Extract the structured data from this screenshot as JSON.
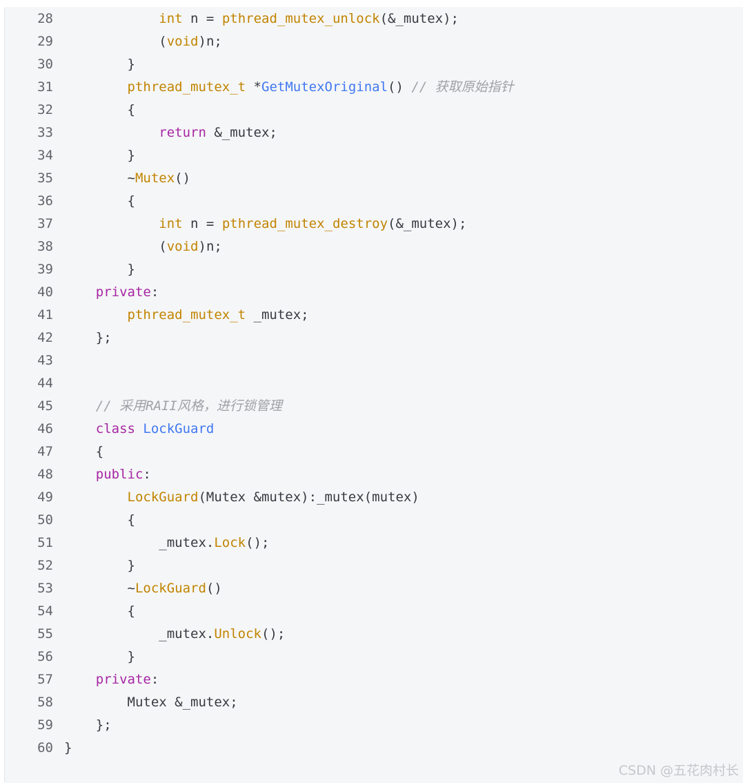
{
  "code_block": {
    "lines": [
      {
        "num": "28",
        "indent": "        ",
        "tokens": [
          {
            "t": "int",
            "c": "type"
          },
          {
            "t": " n = ",
            "c": "p"
          },
          {
            "t": "pthread_mutex_unlock",
            "c": "fn"
          },
          {
            "t": "(&_mutex);",
            "c": "p"
          }
        ]
      },
      {
        "num": "29",
        "indent": "        ",
        "tokens": [
          {
            "t": "(",
            "c": "p"
          },
          {
            "t": "void",
            "c": "type"
          },
          {
            "t": ")n;",
            "c": "p"
          }
        ]
      },
      {
        "num": "30",
        "indent": "    ",
        "tokens": [
          {
            "t": "}",
            "c": "p"
          }
        ]
      },
      {
        "num": "31",
        "indent": "    ",
        "tokens": [
          {
            "t": "pthread_mutex_t",
            "c": "type"
          },
          {
            "t": " *",
            "c": "p"
          },
          {
            "t": "GetMutexOriginal",
            "c": "call"
          },
          {
            "t": "() ",
            "c": "p"
          },
          {
            "t": "// 获取原始指针",
            "c": "cm"
          }
        ]
      },
      {
        "num": "32",
        "indent": "    ",
        "tokens": [
          {
            "t": "{",
            "c": "p"
          }
        ]
      },
      {
        "num": "33",
        "indent": "        ",
        "tokens": [
          {
            "t": "return",
            "c": "kw"
          },
          {
            "t": " &_mutex;",
            "c": "p"
          }
        ]
      },
      {
        "num": "34",
        "indent": "    ",
        "tokens": [
          {
            "t": "}",
            "c": "p"
          }
        ]
      },
      {
        "num": "35",
        "indent": "    ",
        "tokens": [
          {
            "t": "~",
            "c": "p"
          },
          {
            "t": "Mutex",
            "c": "fn"
          },
          {
            "t": "()",
            "c": "p"
          }
        ]
      },
      {
        "num": "36",
        "indent": "    ",
        "tokens": [
          {
            "t": "{",
            "c": "p"
          }
        ]
      },
      {
        "num": "37",
        "indent": "        ",
        "tokens": [
          {
            "t": "int",
            "c": "type"
          },
          {
            "t": " n = ",
            "c": "p"
          },
          {
            "t": "pthread_mutex_destroy",
            "c": "fn"
          },
          {
            "t": "(&_mutex);",
            "c": "p"
          }
        ]
      },
      {
        "num": "38",
        "indent": "        ",
        "tokens": [
          {
            "t": "(",
            "c": "p"
          },
          {
            "t": "void",
            "c": "type"
          },
          {
            "t": ")n;",
            "c": "p"
          }
        ]
      },
      {
        "num": "39",
        "indent": "    ",
        "tokens": [
          {
            "t": "}",
            "c": "p"
          }
        ]
      },
      {
        "num": "40",
        "indent": "",
        "tokens": [
          {
            "t": "private",
            "c": "kw"
          },
          {
            "t": ":",
            "c": "p"
          }
        ]
      },
      {
        "num": "41",
        "indent": "    ",
        "tokens": [
          {
            "t": "pthread_mutex_t",
            "c": "type"
          },
          {
            "t": " _mutex;",
            "c": "p"
          }
        ]
      },
      {
        "num": "42",
        "indent": "",
        "tokens": [
          {
            "t": "};",
            "c": "p"
          }
        ]
      },
      {
        "num": "43",
        "indent": "",
        "tokens": []
      },
      {
        "num": "44",
        "indent": "",
        "tokens": []
      },
      {
        "num": "45",
        "indent": "",
        "tokens": [
          {
            "t": "// 采用RAII风格，进行锁管理",
            "c": "cm"
          }
        ]
      },
      {
        "num": "46",
        "indent": "",
        "tokens": [
          {
            "t": "class",
            "c": "kw"
          },
          {
            "t": " ",
            "c": "p"
          },
          {
            "t": "LockGuard",
            "c": "class"
          }
        ]
      },
      {
        "num": "47",
        "indent": "",
        "tokens": [
          {
            "t": "{",
            "c": "p"
          }
        ]
      },
      {
        "num": "48",
        "indent": "",
        "tokens": [
          {
            "t": "public",
            "c": "kw"
          },
          {
            "t": ":",
            "c": "p"
          }
        ]
      },
      {
        "num": "49",
        "indent": "    ",
        "tokens": [
          {
            "t": "LockGuard",
            "c": "fn"
          },
          {
            "t": "(Mutex &mutex):_mutex(mutex)",
            "c": "p"
          }
        ]
      },
      {
        "num": "50",
        "indent": "    ",
        "tokens": [
          {
            "t": "{",
            "c": "p"
          }
        ]
      },
      {
        "num": "51",
        "indent": "        ",
        "tokens": [
          {
            "t": "_mutex.",
            "c": "p"
          },
          {
            "t": "Lock",
            "c": "fn"
          },
          {
            "t": "();",
            "c": "p"
          }
        ]
      },
      {
        "num": "52",
        "indent": "    ",
        "tokens": [
          {
            "t": "}",
            "c": "p"
          }
        ]
      },
      {
        "num": "53",
        "indent": "    ",
        "tokens": [
          {
            "t": "~",
            "c": "p"
          },
          {
            "t": "LockGuard",
            "c": "fn"
          },
          {
            "t": "()",
            "c": "p"
          }
        ]
      },
      {
        "num": "54",
        "indent": "    ",
        "tokens": [
          {
            "t": "{",
            "c": "p"
          }
        ]
      },
      {
        "num": "55",
        "indent": "        ",
        "tokens": [
          {
            "t": "_mutex.",
            "c": "p"
          },
          {
            "t": "Unlock",
            "c": "fn"
          },
          {
            "t": "();",
            "c": "p"
          }
        ]
      },
      {
        "num": "56",
        "indent": "    ",
        "tokens": [
          {
            "t": "}",
            "c": "p"
          }
        ]
      },
      {
        "num": "57",
        "indent": "",
        "tokens": [
          {
            "t": "private",
            "c": "kw"
          },
          {
            "t": ":",
            "c": "p"
          }
        ]
      },
      {
        "num": "58",
        "indent": "    ",
        "tokens": [
          {
            "t": "Mutex &_mutex;",
            "c": "p"
          }
        ]
      },
      {
        "num": "59",
        "indent": "",
        "tokens": [
          {
            "t": "};",
            "c": "p"
          }
        ]
      },
      {
        "num": "60",
        "indent": "",
        "outer": true,
        "tokens": [
          {
            "t": "}",
            "c": "p"
          }
        ]
      }
    ]
  },
  "watermark": "CSDN @五花肉村长"
}
